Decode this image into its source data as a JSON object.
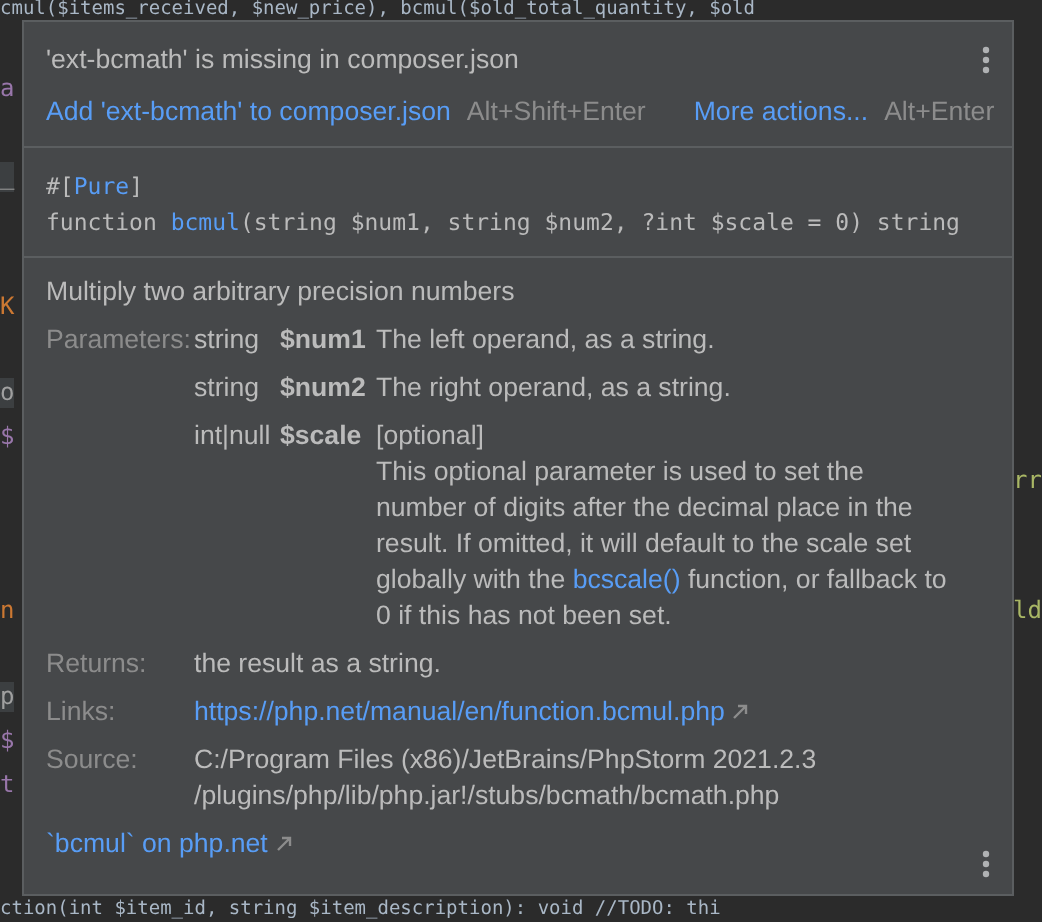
{
  "editor": {
    "top_line": "cmul($items_received, $new_price), bcmul($old_total_quantity, $old",
    "bottom_line": "ction(int $item_id, string $item_description): void   //TODO: thi",
    "fragments": [
      {
        "text": "a",
        "kind": "variable"
      },
      {
        "text": "_",
        "kind": "tab"
      },
      {
        "text": "K",
        "kind": "call"
      },
      {
        "text": "o",
        "kind": "tab"
      },
      {
        "text": "$",
        "kind": "variable"
      },
      {
        "text": "rr",
        "kind": "function_right"
      },
      {
        "text": "n",
        "kind": "call"
      },
      {
        "text": "ld",
        "kind": "function_right"
      },
      {
        "text": "p",
        "kind": "tab"
      },
      {
        "text": "$",
        "kind": "variable"
      },
      {
        "text": "t",
        "kind": "variable"
      }
    ]
  },
  "popup": {
    "problem": "'ext-bcmath' is missing in composer.json",
    "actions": [
      {
        "label": "Add 'ext-bcmath' to composer.json",
        "shortcut": "Alt+Shift+Enter"
      },
      {
        "label": "More actions...",
        "shortcut": "Alt+Enter"
      }
    ],
    "signature": [
      [
        {
          "text": "#[",
          "kind": "plain"
        },
        {
          "text": "Pure",
          "kind": "name"
        },
        {
          "text": "]",
          "kind": "plain"
        }
      ],
      [
        {
          "text": "function ",
          "kind": "plain"
        },
        {
          "text": "bcmul",
          "kind": "name"
        },
        {
          "text": "(string $num1, string $num2, ?int $scale = 0) string",
          "kind": "plain"
        }
      ]
    ],
    "description": "Multiply two arbitrary precision numbers",
    "parameters_label": "Parameters:",
    "parameters": [
      {
        "type": "string",
        "name": "$num1",
        "text": "The left operand, as a string."
      },
      {
        "type": "string",
        "name": "$num2",
        "text": "The right operand, as a string."
      },
      {
        "type": "int|null",
        "name": "$scale",
        "text": "[optional]",
        "detail": {
          "before": "This optional parameter is used to set the number of digits after the decimal place in the result. If omitted, it will default to the scale set globally with the ",
          "link": "bcscale()",
          "after": " function, or fallback to 0 if this has not been set."
        }
      }
    ],
    "returns_label": "Returns:",
    "returns": "the result as a string.",
    "links_label": "Links:",
    "link": "https://php.net/manual/en/function.bcmul.php",
    "source_label": "Source:",
    "source": [
      "C:/Program Files (x86)/JetBrains/PhpStorm 2021.2.3",
      "/plugins/php/lib/php.jar!/stubs/bcmath/bcmath.php"
    ],
    "footer_link": "`bcmul` on php.net"
  }
}
